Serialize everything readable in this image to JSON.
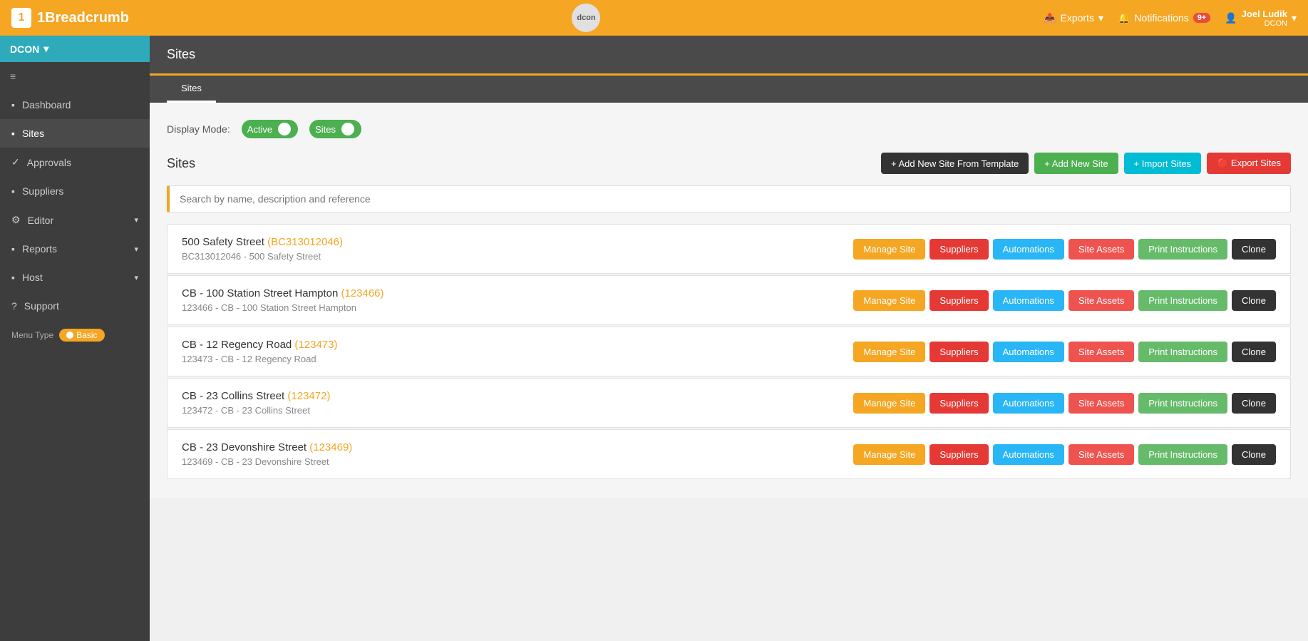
{
  "brand": {
    "logo_text": "1",
    "name": "1Breadcrumb"
  },
  "top_nav": {
    "avatar_text": "dcon",
    "exports_label": "Exports",
    "notifications_label": "Notifications",
    "notification_count": "9+",
    "user_name": "Joel Ludik",
    "user_org": "DCON",
    "chevron": "▾"
  },
  "sidebar": {
    "org_label": "DCON",
    "org_chevron": "▾",
    "menu_icon": "≡",
    "items": [
      {
        "id": "dashboard",
        "label": "Dashboard",
        "icon": "⬛"
      },
      {
        "id": "sites",
        "label": "Sites",
        "icon": "⬛",
        "active": true
      },
      {
        "id": "approvals",
        "label": "Approvals",
        "icon": "✓"
      },
      {
        "id": "suppliers",
        "label": "Suppliers",
        "icon": "👥"
      },
      {
        "id": "editor",
        "label": "Editor",
        "icon": "⚙",
        "has_arrow": true
      },
      {
        "id": "reports",
        "label": "Reports",
        "icon": "≡",
        "has_arrow": true
      },
      {
        "id": "host",
        "label": "Host",
        "icon": "👥",
        "has_arrow": true
      },
      {
        "id": "support",
        "label": "Support",
        "icon": "?"
      }
    ],
    "menu_type_label": "Menu Type",
    "menu_type_value": "Basic"
  },
  "page": {
    "title": "Sites",
    "tab_label": "Sites"
  },
  "display_mode": {
    "label": "Display Mode:",
    "active_label": "Active",
    "sites_label": "Sites"
  },
  "sites_section": {
    "title": "Sites",
    "btn_template": "+ Add New Site From Template",
    "btn_add": "+ Add New Site",
    "btn_import": "+ Import Sites",
    "btn_export": "🔴 Export Sites",
    "search_placeholder": "Search by name, description and reference"
  },
  "sites": [
    {
      "id": 1,
      "name": "500 Safety Street",
      "ref": "BC313012046",
      "desc": "BC313012046 - 500 Safety Street",
      "actions": {
        "manage": "Manage Site",
        "suppliers": "Suppliers",
        "automations": "Automations",
        "assets": "Site Assets",
        "print": "Print Instructions",
        "clone": "Clone"
      }
    },
    {
      "id": 2,
      "name": "CB - 100 Station Street Hampton",
      "ref": "123466",
      "desc": "123466 - CB - 100 Station Street Hampton",
      "actions": {
        "manage": "Manage Site",
        "suppliers": "Suppliers",
        "automations": "Automations",
        "assets": "Site Assets",
        "print": "Print Instructions",
        "clone": "Clone"
      }
    },
    {
      "id": 3,
      "name": "CB - 12 Regency Road",
      "ref": "123473",
      "desc": "123473 - CB - 12 Regency Road",
      "actions": {
        "manage": "Manage Site",
        "suppliers": "Suppliers",
        "automations": "Automations",
        "assets": "Site Assets",
        "print": "Print Instructions",
        "clone": "Clone"
      }
    },
    {
      "id": 4,
      "name": "CB - 23 Collins Street",
      "ref": "123472",
      "desc": "123472 - CB - 23 Collins Street",
      "actions": {
        "manage": "Manage Site",
        "suppliers": "Suppliers",
        "automations": "Automations",
        "assets": "Site Assets",
        "print": "Print Instructions",
        "clone": "Clone"
      }
    },
    {
      "id": 5,
      "name": "CB - 23 Devonshire Street",
      "ref": "123469",
      "desc": "123469 - CB - 23 Devonshire Street",
      "actions": {
        "manage": "Manage Site",
        "suppliers": "Suppliers",
        "automations": "Automations",
        "assets": "Site Assets",
        "print": "Print Instructions",
        "clone": "Clone"
      }
    }
  ]
}
